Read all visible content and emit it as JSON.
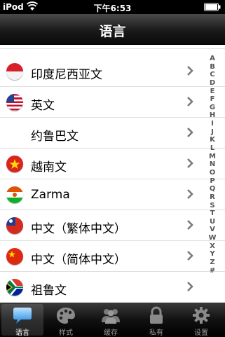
{
  "status": {
    "carrier": "iPod",
    "time": "下午6:53"
  },
  "nav": {
    "title": "语言"
  },
  "rows": [
    {
      "label": "印度尼西亚文",
      "flag": "indonesia-flag"
    },
    {
      "label": "英文",
      "flag": "usa-flag"
    },
    {
      "label": "约鲁巴文",
      "flag": "none"
    },
    {
      "label": "越南文",
      "flag": "vietnam-flag"
    },
    {
      "label": "Zarma",
      "flag": "niger-flag"
    },
    {
      "label": "中文（繁体中文）",
      "flag": "taiwan-flag"
    },
    {
      "label": "中文（简体中文）",
      "flag": "china-flag"
    },
    {
      "label": "祖鲁文",
      "flag": "south-africa-flag"
    }
  ],
  "index": [
    "A",
    "B",
    "C",
    "D",
    "E",
    "F",
    "G",
    "H",
    "I",
    "J",
    "K",
    "L",
    "M",
    "N",
    "O",
    "P",
    "Q",
    "R",
    "S",
    "T",
    "U",
    "V",
    "W",
    "X",
    "Y",
    "Z",
    "#"
  ],
  "tabs": [
    {
      "label": "语言",
      "icon": "speech-bubble-icon",
      "active": true
    },
    {
      "label": "样式",
      "icon": "palette-icon",
      "active": false
    },
    {
      "label": "缓存",
      "icon": "people-icon",
      "active": false
    },
    {
      "label": "私有",
      "icon": "lock-icon",
      "active": false
    },
    {
      "label": "设置",
      "icon": "gear-icon",
      "active": false
    }
  ]
}
